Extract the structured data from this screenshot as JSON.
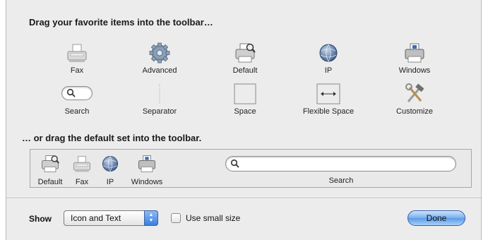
{
  "headings": {
    "favorites": "Drag your favorite items into the toolbar…",
    "default_set": "… or drag the default set into the toolbar."
  },
  "palette": [
    {
      "label": "Fax",
      "icon": "fax-icon"
    },
    {
      "label": "Advanced",
      "icon": "gear-icon"
    },
    {
      "label": "Default",
      "icon": "printer-magnifier-icon"
    },
    {
      "label": "IP",
      "icon": "globe-icon"
    },
    {
      "label": "Windows",
      "icon": "printer-icon"
    },
    {
      "label": "Search",
      "icon": "search-icon"
    },
    {
      "label": "Separator",
      "icon": "separator-icon"
    },
    {
      "label": "Space",
      "icon": "space-icon"
    },
    {
      "label": "Flexible Space",
      "icon": "flexible-space-icon"
    },
    {
      "label": "Customize",
      "icon": "hammer-wrench-icon"
    }
  ],
  "default_set": [
    {
      "label": "Default",
      "icon": "printer-magnifier-icon"
    },
    {
      "label": "Fax",
      "icon": "fax-icon"
    },
    {
      "label": "IP",
      "icon": "globe-icon"
    },
    {
      "label": "Windows",
      "icon": "printer-icon"
    },
    {
      "label": "Search",
      "icon": "search-icon"
    }
  ],
  "footer": {
    "show_label": "Show",
    "show_value": "Icon and Text",
    "small_size_label": "Use small size",
    "small_size_checked": false,
    "done_label": "Done"
  }
}
